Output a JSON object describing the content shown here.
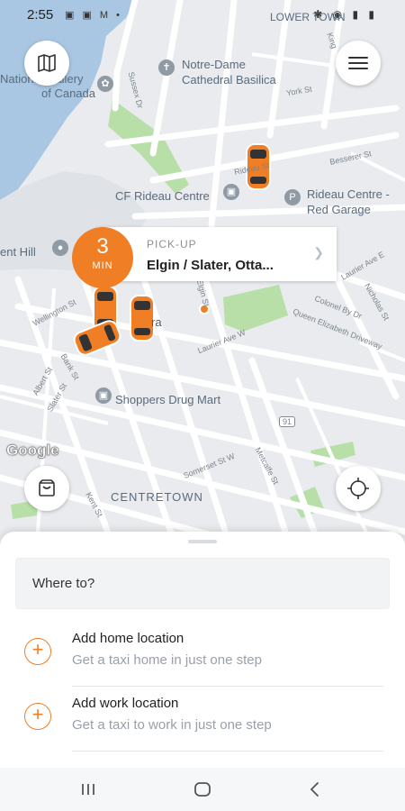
{
  "status_bar": {
    "time": "2:55",
    "left_icons": "▣ ▣ M •",
    "right_icons": "✱ ◉ ▮ ▮"
  },
  "map": {
    "labels": {
      "lower_town": "LOWER TOWN",
      "gallery_line1": "National Gallery",
      "gallery_line2": "of Canada",
      "notre_dame_line1": "Notre-Dame",
      "notre_dame_line2": "Cathedral Basilica",
      "rideau_centre": "CF Rideau Centre",
      "garage_line1": "Rideau Centre -",
      "garage_line2": "Red Garage",
      "ment_hill": "ent Hill",
      "shoppers": "Shoppers Drug Mart",
      "centretown": "CENTRETOWN",
      "ottawa_partial": "ra"
    },
    "streets": {
      "wellington": "Wellington St",
      "sparks": "Sparks St",
      "bank": "Bank St",
      "albert": "Albert St",
      "slater": "Slater St",
      "laurier": "Laurier Ave W",
      "somerset": "Somerset St W",
      "metcalfe": "Metcalfe St",
      "rideau": "Rideau St",
      "besserer": "Besserer St",
      "york": "York St",
      "sussex": "Sussex Dr",
      "king": "King",
      "laurier_east": "Laurier Ave E",
      "colonel_by": "Colonel By Dr",
      "queen_eliz": "Queen Elizabeth Driveway",
      "nicholas": "Nicholas St",
      "elgin": "Elgin St",
      "kent": "Kent St",
      "route": "91"
    },
    "google_logo": "Google",
    "colors": {
      "water": "#a9c7e3",
      "park": "#b8dfa8",
      "road": "#ffffff",
      "land": "#e9ebee",
      "car_body": "#f07e25"
    }
  },
  "pickup": {
    "eta_number": "3",
    "eta_unit": "MIN",
    "label": "PICK-UP",
    "address": "Elgin / Slater, Otta..."
  },
  "sheet": {
    "where_to": "Where to?",
    "home": {
      "title": "Add home location",
      "subtitle": "Get a taxi home in just one step"
    },
    "work": {
      "title": "Add work location",
      "subtitle": "Get a taxi to work in just one step"
    }
  },
  "icons": {
    "map_toggle": "map-icon",
    "menu": "menu-icon",
    "bag": "bag-icon",
    "locate": "crosshair-icon",
    "accent": "#f07e25"
  }
}
